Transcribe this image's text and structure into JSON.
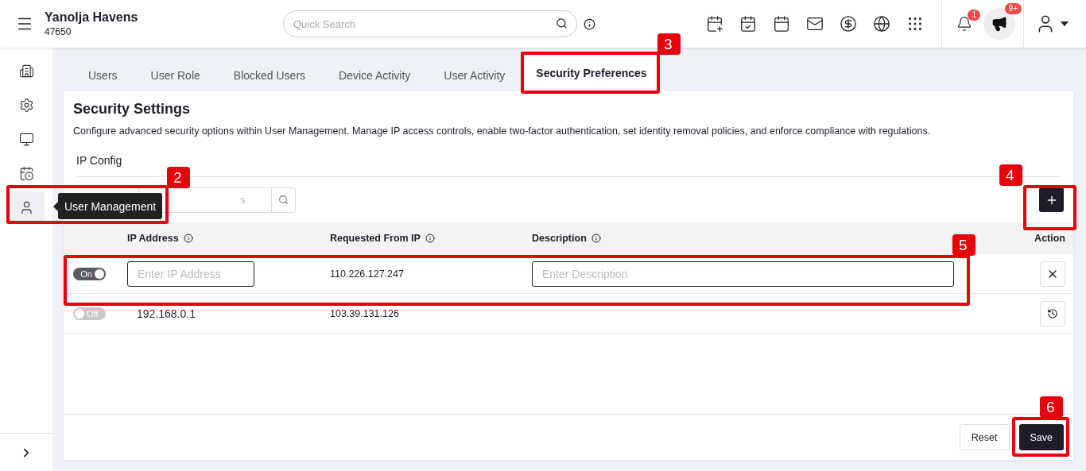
{
  "header": {
    "title": "Yanolja Havens",
    "subtitle": "47650",
    "search": {
      "placeholder": "Quick Search"
    },
    "notification_badge": "1",
    "announcement_badge": "9+"
  },
  "sidebar": {
    "items": [
      {
        "selected": false
      },
      {
        "selected": false
      },
      {
        "selected": false
      },
      {
        "selected": false
      },
      {
        "selected": true
      }
    ],
    "tooltip": "User Management"
  },
  "tabs": [
    {
      "label": "Users",
      "selected": false
    },
    {
      "label": "User Role",
      "selected": false
    },
    {
      "label": "Blocked Users",
      "selected": false
    },
    {
      "label": "Device Activity",
      "selected": false
    },
    {
      "label": "User Activity",
      "selected": false
    },
    {
      "label": "Security Preferences",
      "selected": true
    }
  ],
  "card": {
    "title": "Security Settings",
    "description": "Configure advanced security options within User Management. Manage IP access controls, enable two-factor authentication, set identity removal policies, and enforce compliance with regulations.",
    "section_title": "IP Config",
    "filter": {
      "placeholder": "s"
    },
    "table": {
      "columns": [
        {
          "label": "IP Address",
          "info": true
        },
        {
          "label": "Requested From IP",
          "info": true
        },
        {
          "label": "Description",
          "info": true
        },
        {
          "label": "Action",
          "info": false
        }
      ],
      "rows": [
        {
          "kind": "edit",
          "on": true,
          "toggle_label": "On",
          "ip_placeholder": "Enter IP Address",
          "requested_from": "110.226.127.247",
          "description_placeholder": "Enter Description"
        },
        {
          "kind": "view",
          "on": false,
          "toggle_label": "Off",
          "ip": "192.168.0.1",
          "requested_from": "103.39.131.126"
        }
      ]
    },
    "buttons": [
      {
        "label": "Reset",
        "kind": "secondary"
      },
      {
        "label": "Save",
        "kind": "primary"
      }
    ]
  },
  "annotations": [
    {
      "label": "2"
    },
    {
      "label": "3"
    },
    {
      "label": "4"
    },
    {
      "label": "5"
    },
    {
      "label": "6"
    }
  ]
}
